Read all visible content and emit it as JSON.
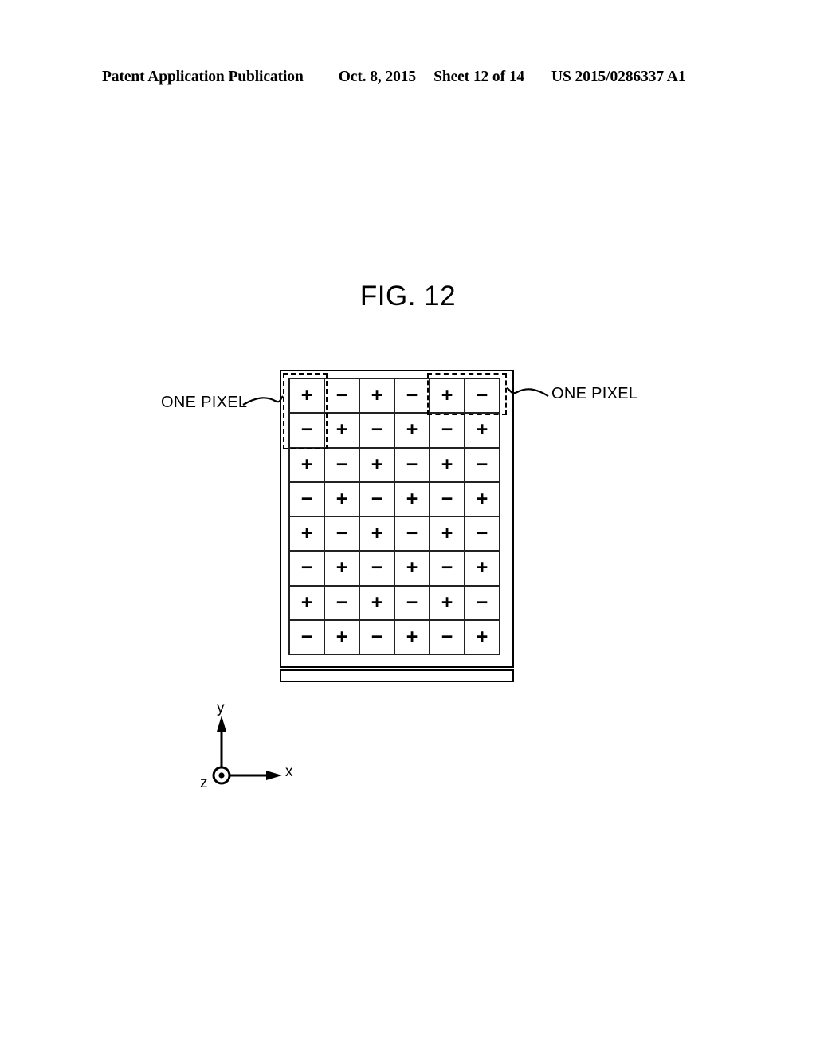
{
  "header": {
    "title": "Patent Application Publication",
    "date": "Oct. 8, 2015",
    "sheet": "Sheet 12 of 14",
    "publication_number": "US 2015/0286337 A1"
  },
  "figure": {
    "title": "FIG. 12",
    "grid": {
      "rows": 8,
      "columns": 6,
      "pattern_description": "checkerboard of alternating polarity signs",
      "cells": [
        [
          "+",
          "−",
          "+",
          "−",
          "+",
          "−"
        ],
        [
          "−",
          "+",
          "−",
          "+",
          "−",
          "+"
        ],
        [
          "+",
          "−",
          "+",
          "−",
          "+",
          "−"
        ],
        [
          "−",
          "+",
          "−",
          "+",
          "−",
          "+"
        ],
        [
          "+",
          "−",
          "+",
          "−",
          "+",
          "−"
        ],
        [
          "−",
          "+",
          "−",
          "+",
          "−",
          "+"
        ],
        [
          "+",
          "−",
          "+",
          "−",
          "+",
          "−"
        ],
        [
          "−",
          "+",
          "−",
          "+",
          "−",
          "+"
        ]
      ]
    },
    "annotations": {
      "left_label": "ONE PIXEL",
      "right_label": "ONE PIXEL"
    },
    "axes": {
      "y": "y",
      "x": "x",
      "z": "z"
    }
  },
  "colors": {
    "ink": "#000000",
    "grid_line": "#222222",
    "background": "#ffffff"
  }
}
